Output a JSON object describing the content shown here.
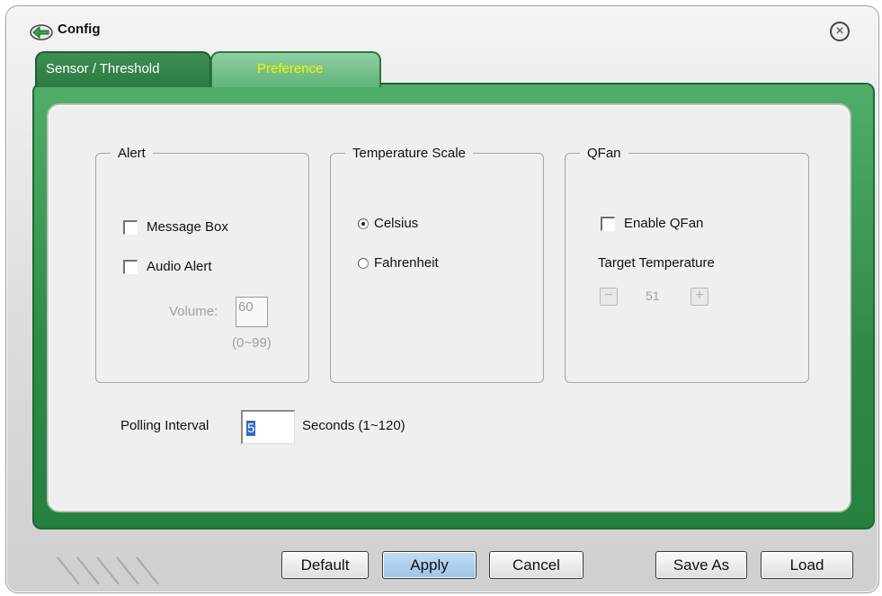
{
  "window": {
    "title": "Config",
    "close_icon": "close-circle-icon"
  },
  "tabs": [
    {
      "label": "Sensor / Threshold",
      "active": false
    },
    {
      "label": "Preference",
      "active": true
    }
  ],
  "alert": {
    "legend": "Alert",
    "message_box": {
      "label": "Message Box",
      "checked": false
    },
    "audio_alert": {
      "label": "Audio Alert",
      "checked": false
    },
    "volume_label": "Volume:",
    "volume_value": "60",
    "volume_range": "(0~99)"
  },
  "temperature_scale": {
    "legend": "Temperature Scale",
    "options": [
      {
        "label": "Celsius",
        "selected": true
      },
      {
        "label": "Fahrenheit",
        "selected": false
      }
    ]
  },
  "qfan": {
    "legend": "QFan",
    "enable": {
      "label": "Enable QFan",
      "checked": false
    },
    "target_label": "Target Temperature",
    "target_value": "51"
  },
  "polling": {
    "label": "Polling Interval",
    "value": "5",
    "suffix": "Seconds  (1~120)"
  },
  "buttons": {
    "default": "Default",
    "apply": "Apply",
    "cancel": "Cancel",
    "save_as": "Save As",
    "load": "Load"
  },
  "colors": {
    "accent_green": "#2f8a47",
    "active_tab_text": "#f7f300",
    "apply_button": "#9cc4e8"
  }
}
